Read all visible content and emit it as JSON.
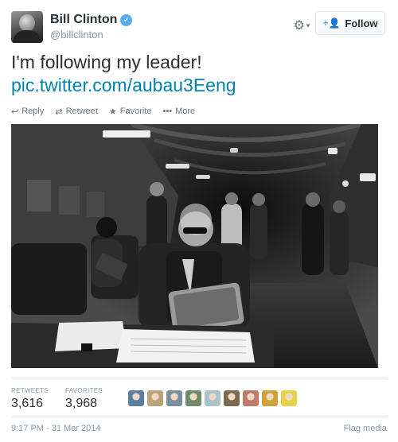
{
  "user": {
    "fullname": "Bill Clinton",
    "username": "@billclinton",
    "verified": true
  },
  "header": {
    "settings_icon": "gear-icon",
    "follow_label": "Follow",
    "follow_icon": "add-user-icon"
  },
  "tweet": {
    "text": "I'm following my leader!",
    "link": "pic.twitter.com/aubau3Eeng"
  },
  "actions": [
    {
      "label": "Reply",
      "icon": "reply-icon"
    },
    {
      "label": "Retweet",
      "icon": "retweet-icon"
    },
    {
      "label": "Favorite",
      "icon": "star-icon"
    },
    {
      "label": "More",
      "icon": "more-icon"
    }
  ],
  "stats": {
    "retweets_label": "RETWEETS",
    "retweets_value": "3,616",
    "favorites_label": "FAVORITES",
    "favorites_value": "3,968"
  },
  "favoriters": [
    {
      "color": "#5a7fa0"
    },
    {
      "color": "#b9a47c"
    },
    {
      "color": "#7b8f9c"
    },
    {
      "color": "#6e8b6a"
    },
    {
      "color": "#a9c4c9"
    },
    {
      "color": "#7a6a4e"
    },
    {
      "color": "#c07a6a"
    },
    {
      "color": "#d0a23a"
    },
    {
      "color": "#e3d24a"
    }
  ],
  "footer": {
    "timestamp": "9:17 PM - 31 Mar 2014",
    "flag_label": "Flag media"
  },
  "colors": {
    "link": "#0084b4",
    "verified": "#55acee",
    "muted": "#8899a6"
  }
}
